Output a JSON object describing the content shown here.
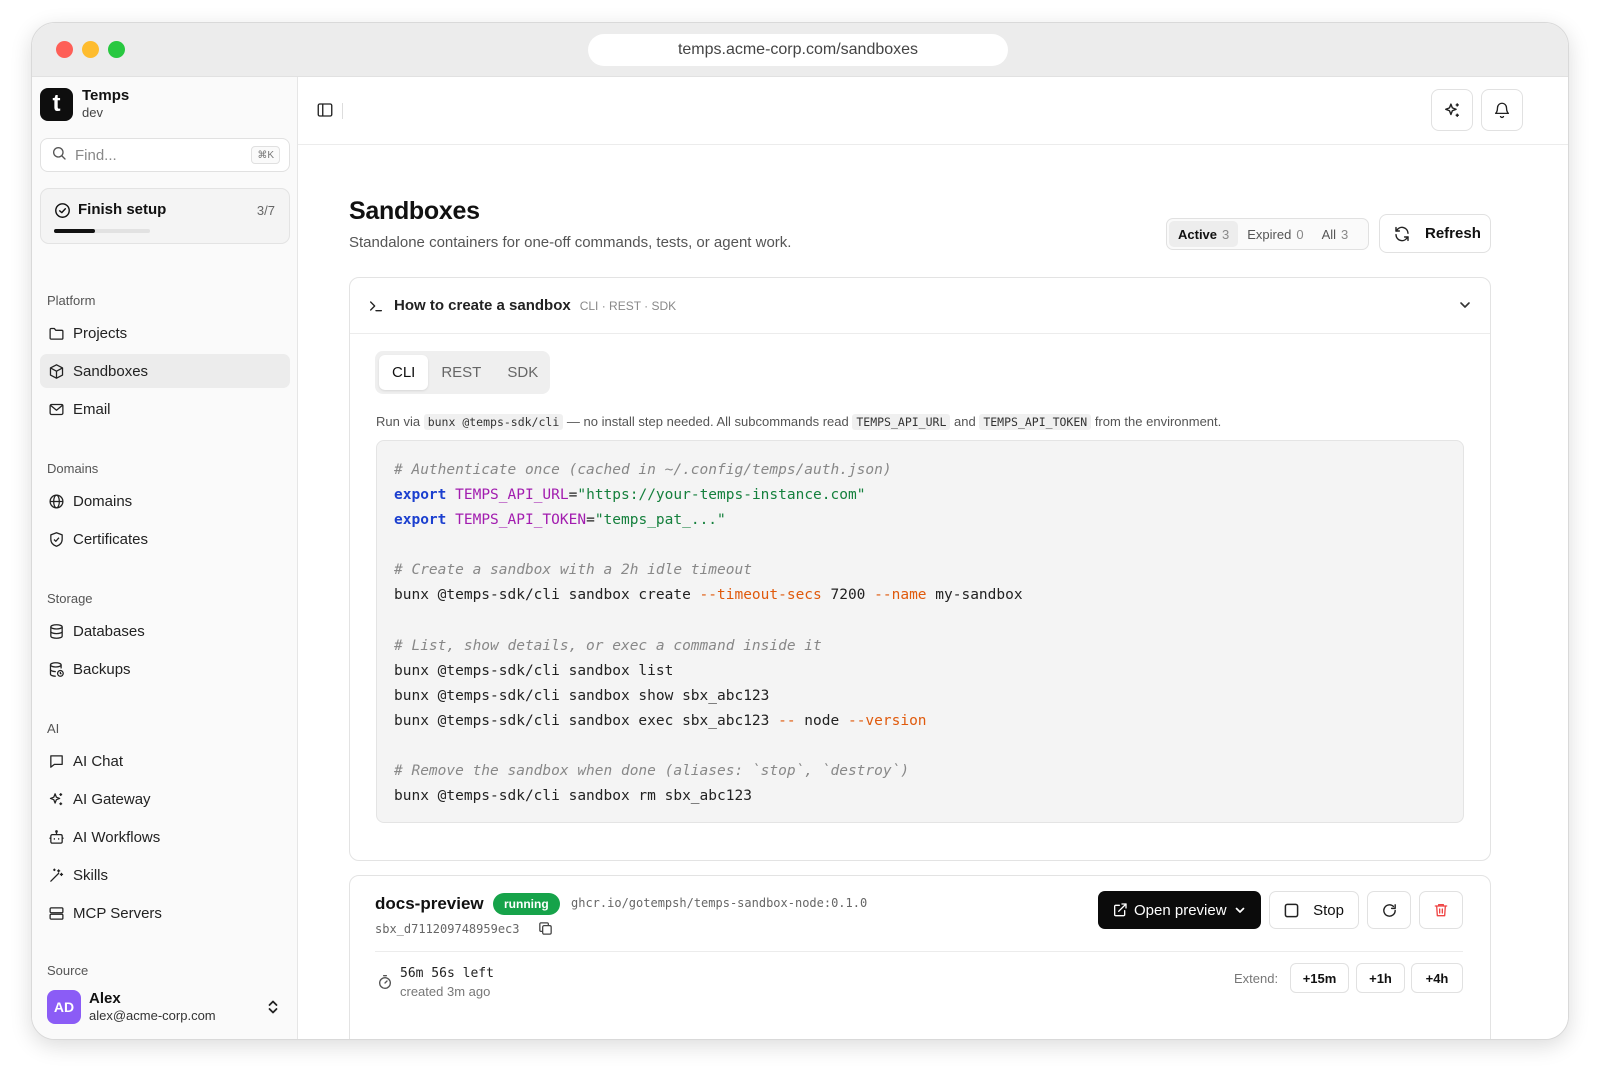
{
  "browser": {
    "url": "temps.acme-corp.com/sandboxes"
  },
  "brand": {
    "name": "Temps",
    "env": "dev",
    "logo_letter": "t"
  },
  "search": {
    "placeholder": "Find...",
    "shortcut": "⌘K"
  },
  "setup": {
    "label": "Finish setup",
    "count": "3/7",
    "progress": 0.43
  },
  "sidebar": {
    "sections": [
      {
        "title": "Platform",
        "items": [
          {
            "label": "Projects",
            "icon": "folder-icon"
          },
          {
            "label": "Sandboxes",
            "icon": "box-icon",
            "active": true
          },
          {
            "label": "Email",
            "icon": "mail-icon"
          }
        ]
      },
      {
        "title": "Domains",
        "items": [
          {
            "label": "Domains",
            "icon": "globe-icon"
          },
          {
            "label": "Certificates",
            "icon": "shield-icon"
          }
        ]
      },
      {
        "title": "Storage",
        "items": [
          {
            "label": "Databases",
            "icon": "database-icon"
          },
          {
            "label": "Backups",
            "icon": "database-backup-icon"
          }
        ]
      },
      {
        "title": "AI",
        "items": [
          {
            "label": "AI Chat",
            "icon": "chat-icon"
          },
          {
            "label": "AI Gateway",
            "icon": "sparkles-icon"
          },
          {
            "label": "AI Workflows",
            "icon": "bot-icon"
          },
          {
            "label": "Skills",
            "icon": "wand-icon"
          },
          {
            "label": "MCP Servers",
            "icon": "server-icon"
          }
        ]
      },
      {
        "title": "Source",
        "items": []
      }
    ]
  },
  "user": {
    "initials": "AD",
    "name": "Alex",
    "email": "alex@acme-corp.com"
  },
  "page": {
    "title": "Sandboxes",
    "subtitle": "Standalone containers for one-off commands, tests, or agent work.",
    "filters": [
      {
        "label": "Active",
        "count": "3",
        "active": true
      },
      {
        "label": "Expired",
        "count": "0"
      },
      {
        "label": "All",
        "count": "3"
      }
    ],
    "refresh_label": "Refresh"
  },
  "howto": {
    "title": "How to create a sandbox",
    "tags": "CLI · REST · SDK",
    "tabs": [
      "CLI",
      "REST",
      "SDK"
    ],
    "active_tab": "CLI",
    "run_via": {
      "prefix": "Run via",
      "cmd": "bunx @temps-sdk/cli",
      "middle": "— no install step needed. All subcommands read",
      "var1": "TEMPS_API_URL",
      "and": "and",
      "var2": "TEMPS_API_TOKEN",
      "suffix": "from the environment."
    },
    "code": [
      [
        {
          "t": "# Authenticate once (cached in ~/.config/temps/auth.json)",
          "c": "com"
        }
      ],
      [
        {
          "t": "export",
          "c": "kw"
        },
        {
          "t": " "
        },
        {
          "t": "TEMPS_API_URL",
          "c": "var"
        },
        {
          "t": "="
        },
        {
          "t": "\"https://your-temps-instance.com\"",
          "c": "str"
        }
      ],
      [
        {
          "t": "export",
          "c": "kw"
        },
        {
          "t": " "
        },
        {
          "t": "TEMPS_API_TOKEN",
          "c": "var"
        },
        {
          "t": "="
        },
        {
          "t": "\"temps_pat_...\"",
          "c": "str"
        }
      ],
      [],
      [
        {
          "t": "# Create a sandbox with a 2h idle timeout",
          "c": "com"
        }
      ],
      [
        {
          "t": "bunx @temps-sdk/cli sandbox create "
        },
        {
          "t": "--timeout-secs",
          "c": "flag"
        },
        {
          "t": " 7200 "
        },
        {
          "t": "--name",
          "c": "flag"
        },
        {
          "t": " my-sandbox"
        }
      ],
      [],
      [
        {
          "t": "# List, show details, or exec a command inside it",
          "c": "com"
        }
      ],
      [
        {
          "t": "bunx @temps-sdk/cli sandbox list"
        }
      ],
      [
        {
          "t": "bunx @temps-sdk/cli sandbox show sbx_abc123"
        }
      ],
      [
        {
          "t": "bunx @temps-sdk/cli sandbox exec sbx_abc123 "
        },
        {
          "t": "--",
          "c": "flag"
        },
        {
          "t": " node "
        },
        {
          "t": "--version",
          "c": "flag"
        }
      ],
      [],
      [
        {
          "t": "# Remove the sandbox when done (aliases: `stop`, `destroy`)",
          "c": "com"
        }
      ],
      [
        {
          "t": "bunx @temps-sdk/cli sandbox rm sbx_abc123"
        }
      ]
    ]
  },
  "sandbox": {
    "name": "docs-preview",
    "status": "running",
    "image": "ghcr.io/gotempsh/temps-sandbox-node:0.1.0",
    "id": "sbx_d711209748959ec3",
    "open_preview_label": "Open preview",
    "stop_label": "Stop",
    "time_left": "56m 56s left",
    "created": "created 3m ago",
    "extend_label": "Extend:",
    "extend_options": [
      "+15m",
      "+1h",
      "+4h"
    ]
  },
  "colors": {
    "running": "#16a34a",
    "danger": "#ef4444",
    "avatar": "#8b5cf6"
  }
}
